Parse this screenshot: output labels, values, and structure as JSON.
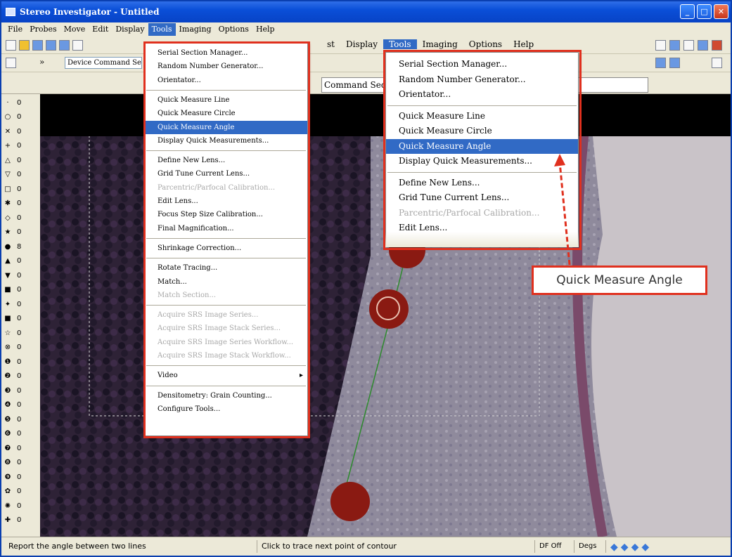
{
  "window": {
    "title": "Stereo Investigator - Untitled",
    "controls": {
      "minimize": "_",
      "maximize": "□",
      "close": "✕"
    }
  },
  "menubar": {
    "items": [
      "File",
      "Probes",
      "Move",
      "Edit",
      "Display",
      "Tools",
      "Imaging",
      "Options",
      "Help"
    ],
    "active": "Tools"
  },
  "zoom_menubar": {
    "items": [
      "st",
      "Display",
      "Tools",
      "Imaging",
      "Options",
      "Help"
    ]
  },
  "toolbar": {
    "command_sequence_placeholder": "Device Command Seq",
    "zoom_command_label": "Command Seq"
  },
  "left_panel": {
    "markers": [
      {
        "symbol": "·",
        "count": "0"
      },
      {
        "symbol": "○",
        "count": "0"
      },
      {
        "symbol": "✕",
        "count": "0"
      },
      {
        "symbol": "+",
        "count": "0"
      },
      {
        "symbol": "△",
        "count": "0"
      },
      {
        "symbol": "▽",
        "count": "0"
      },
      {
        "symbol": "□",
        "count": "0"
      },
      {
        "symbol": "✱",
        "count": "0"
      },
      {
        "symbol": "◇",
        "count": "0"
      },
      {
        "symbol": "★",
        "count": "0"
      },
      {
        "symbol": "●",
        "count": "8"
      },
      {
        "symbol": "▲",
        "count": "0"
      },
      {
        "symbol": "▼",
        "count": "0"
      },
      {
        "symbol": "■",
        "count": "0"
      },
      {
        "symbol": "✦",
        "count": "0"
      },
      {
        "symbol": "■",
        "count": "0"
      },
      {
        "symbol": "☆",
        "count": "0"
      },
      {
        "symbol": "⊗",
        "count": "0"
      },
      {
        "symbol": "❶",
        "count": "0"
      },
      {
        "symbol": "❷",
        "count": "0"
      },
      {
        "symbol": "❸",
        "count": "0"
      },
      {
        "symbol": "❹",
        "count": "0"
      },
      {
        "symbol": "❺",
        "count": "0"
      },
      {
        "symbol": "❻",
        "count": "0"
      },
      {
        "symbol": "❼",
        "count": "0"
      },
      {
        "symbol": "❽",
        "count": "0"
      },
      {
        "symbol": "❾",
        "count": "0"
      },
      {
        "symbol": "✿",
        "count": "0"
      },
      {
        "symbol": "✺",
        "count": "0"
      },
      {
        "symbol": "✚",
        "count": "0"
      }
    ]
  },
  "tools_menu": {
    "items": [
      {
        "label": "Serial Section Manager...",
        "state": "normal"
      },
      {
        "label": "Random Number Generator...",
        "state": "normal"
      },
      {
        "label": "Orientator...",
        "state": "normal"
      },
      {
        "label": "Quick Measure Line",
        "state": "normal"
      },
      {
        "label": "Quick Measure Circle",
        "state": "normal"
      },
      {
        "label": "Quick Measure Angle",
        "state": "highlighted"
      },
      {
        "label": "Display Quick Measurements...",
        "state": "normal"
      },
      {
        "label": "Define New Lens...",
        "state": "normal"
      },
      {
        "label": "Grid Tune Current Lens...",
        "state": "normal"
      },
      {
        "label": "Parcentric/Parfocal Calibration...",
        "state": "disabled"
      },
      {
        "label": "Edit Lens...",
        "state": "normal"
      },
      {
        "label": "Focus Step Size Calibration...",
        "state": "normal"
      },
      {
        "label": "Final Magnification...",
        "state": "normal"
      },
      {
        "label": "Shrinkage Correction...",
        "state": "normal"
      },
      {
        "label": "Rotate Tracing...",
        "state": "normal"
      },
      {
        "label": "Match...",
        "state": "normal"
      },
      {
        "label": "Match Section...",
        "state": "disabled"
      },
      {
        "label": "Acquire SRS Image Series...",
        "state": "disabled"
      },
      {
        "label": "Acquire SRS Image Stack Series...",
        "state": "disabled"
      },
      {
        "label": "Acquire SRS Image Series Workflow...",
        "state": "disabled"
      },
      {
        "label": "Acquire SRS Image Stack Workflow...",
        "state": "disabled"
      },
      {
        "label": "Video",
        "state": "submenu"
      },
      {
        "label": "Densitometry: Grain Counting...",
        "state": "normal"
      },
      {
        "label": "Configure Tools...",
        "state": "normal"
      }
    ]
  },
  "zoom_menu": {
    "items": [
      {
        "label": "Serial Section Manager...",
        "state": "normal"
      },
      {
        "label": "Random Number Generator...",
        "state": "normal"
      },
      {
        "label": "Orientator...",
        "state": "normal"
      },
      {
        "label": "Quick Measure Line",
        "state": "normal"
      },
      {
        "label": "Quick Measure Circle",
        "state": "normal"
      },
      {
        "label": "Quick Measure Angle",
        "state": "highlighted"
      },
      {
        "label": "Display Quick Measurements...",
        "state": "normal"
      },
      {
        "label": "Define New Lens...",
        "state": "normal"
      },
      {
        "label": "Grid Tune Current Lens...",
        "state": "normal"
      },
      {
        "label": "Parcentric/Parfocal Calibration...",
        "state": "disabled"
      },
      {
        "label": "Edit Lens...",
        "state": "normal"
      }
    ]
  },
  "callout": {
    "text": "Quick Measure Angle"
  },
  "statusbar": {
    "hint": "Report the angle between two lines",
    "action": "Click to trace next point of contour",
    "df": "DF Off",
    "units": "Degs"
  },
  "colors": {
    "highlight": "#316ac5",
    "callout_red": "#e0301e",
    "titlebar": "#0a4fd8",
    "marker_dot": "#8a1a12"
  }
}
